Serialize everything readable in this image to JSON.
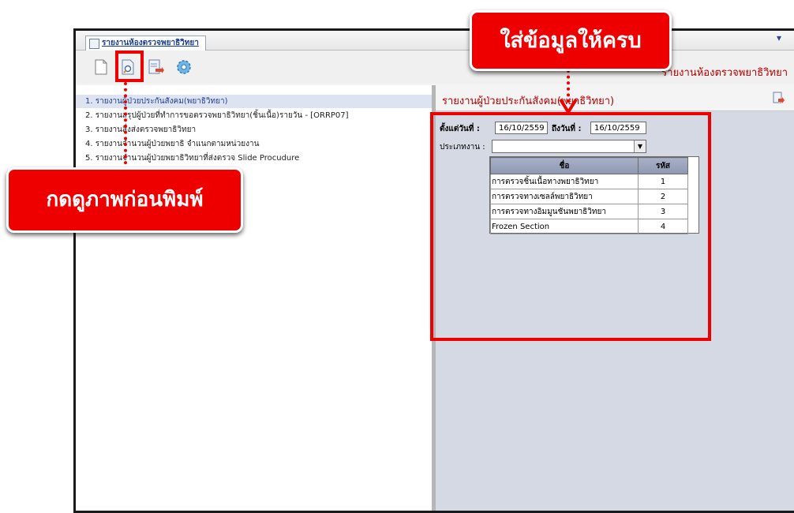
{
  "window": {
    "tab_label": "รายงานห้องตรวจพยาธิวิทยา",
    "menu_arrow": "▾",
    "toolbar_title": "รายงานห้องตรวจพยาธิวิทยา"
  },
  "toolbar": {
    "icons": [
      "new-document-icon",
      "print-preview-icon",
      "export-icon",
      "settings-gear-icon"
    ]
  },
  "reports": [
    "1. รายงานผู้ป่วยประกันสังคม(พยาธิวิทยา)",
    "2. รายงานสรุปผู้ป่วยที่ทำการขอตรวจพยาธิวิทยา(ชิ้นเนื้อ)รายวัน - [ORRP07]",
    "3. รายงานสิ่งส่งตรวจพยาธิวิทยา",
    "4. รายงานจำนวนผู้ป่วยพยาธิ จำแนกตามหน่วยงาน",
    "5. รายงานจำนวนผู้ป่วยพยาธิวิทยาที่ส่งตรวจ Slide Procudure"
  ],
  "form": {
    "title": "รายงานผู้ป่วยประกันสังคม(พยาธิวิทยา)",
    "from_label": "ตั้งแต่วันที่ :",
    "from_value": "16/10/2559",
    "to_label": "ถึงวันที่ :",
    "to_value": "16/10/2559",
    "type_label": "ประเภทงาน :",
    "type_value": "",
    "grid_headers": {
      "name": "ชื่อ",
      "code": "รหัส"
    },
    "grid_rows": [
      {
        "name": "การตรวจชิ้นเนื้อทางพยาธิวิทยา",
        "code": "1"
      },
      {
        "name": "การตรวจทางเซลล์พยาธิวิทยา",
        "code": "2"
      },
      {
        "name": "การตรวจทางอิมมูนชันพยาธิวิทยา",
        "code": "3"
      },
      {
        "name": "Frozen Section",
        "code": "4"
      }
    ]
  },
  "annotations": {
    "fill_callout": "ใส่ข้อมูลให้ครบ",
    "preview_callout": "กดดูภาพก่อนพิมพ์",
    "color": "#ee0000"
  }
}
